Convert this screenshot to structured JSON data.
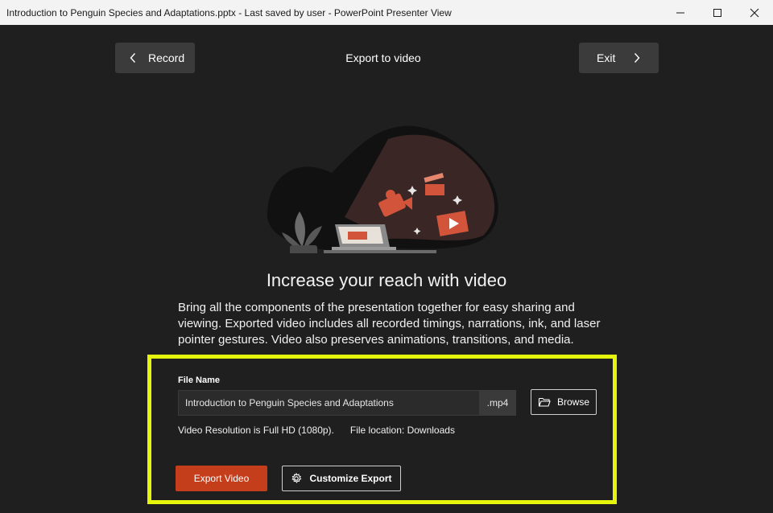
{
  "window": {
    "title": "Introduction to Penguin Species and Adaptations.pptx  -  Last saved by user - PowerPoint Presenter View"
  },
  "toolbar": {
    "record_label": "Record",
    "heading": "Export to video",
    "exit_label": "Exit"
  },
  "content": {
    "headline": "Increase your reach with video",
    "description": "Bring all the components of the presentation together for easy sharing and viewing. Exported video includes all recorded timings, narrations, ink, and laser pointer gestures. Video also preserves animations, transitions, and media."
  },
  "export_form": {
    "file_name_label": "File Name",
    "file_name_value": "Introduction to Penguin Species and Adaptations",
    "extension": ".mp4",
    "browse_label": "Browse",
    "resolution_text": "Video Resolution is Full HD (1080p).",
    "location_text": "File location: Downloads",
    "export_label": "Export Video",
    "customize_label": "Customize Export"
  },
  "colors": {
    "accent": "#c43e1c",
    "highlight": "#e5f50c",
    "background": "#1f1f1f",
    "titlebar": "#f3f3f3"
  },
  "icons": [
    "chevron-left-icon",
    "chevron-right-icon",
    "minimize-icon",
    "maximize-icon",
    "close-icon",
    "folder-icon",
    "gear-icon"
  ]
}
